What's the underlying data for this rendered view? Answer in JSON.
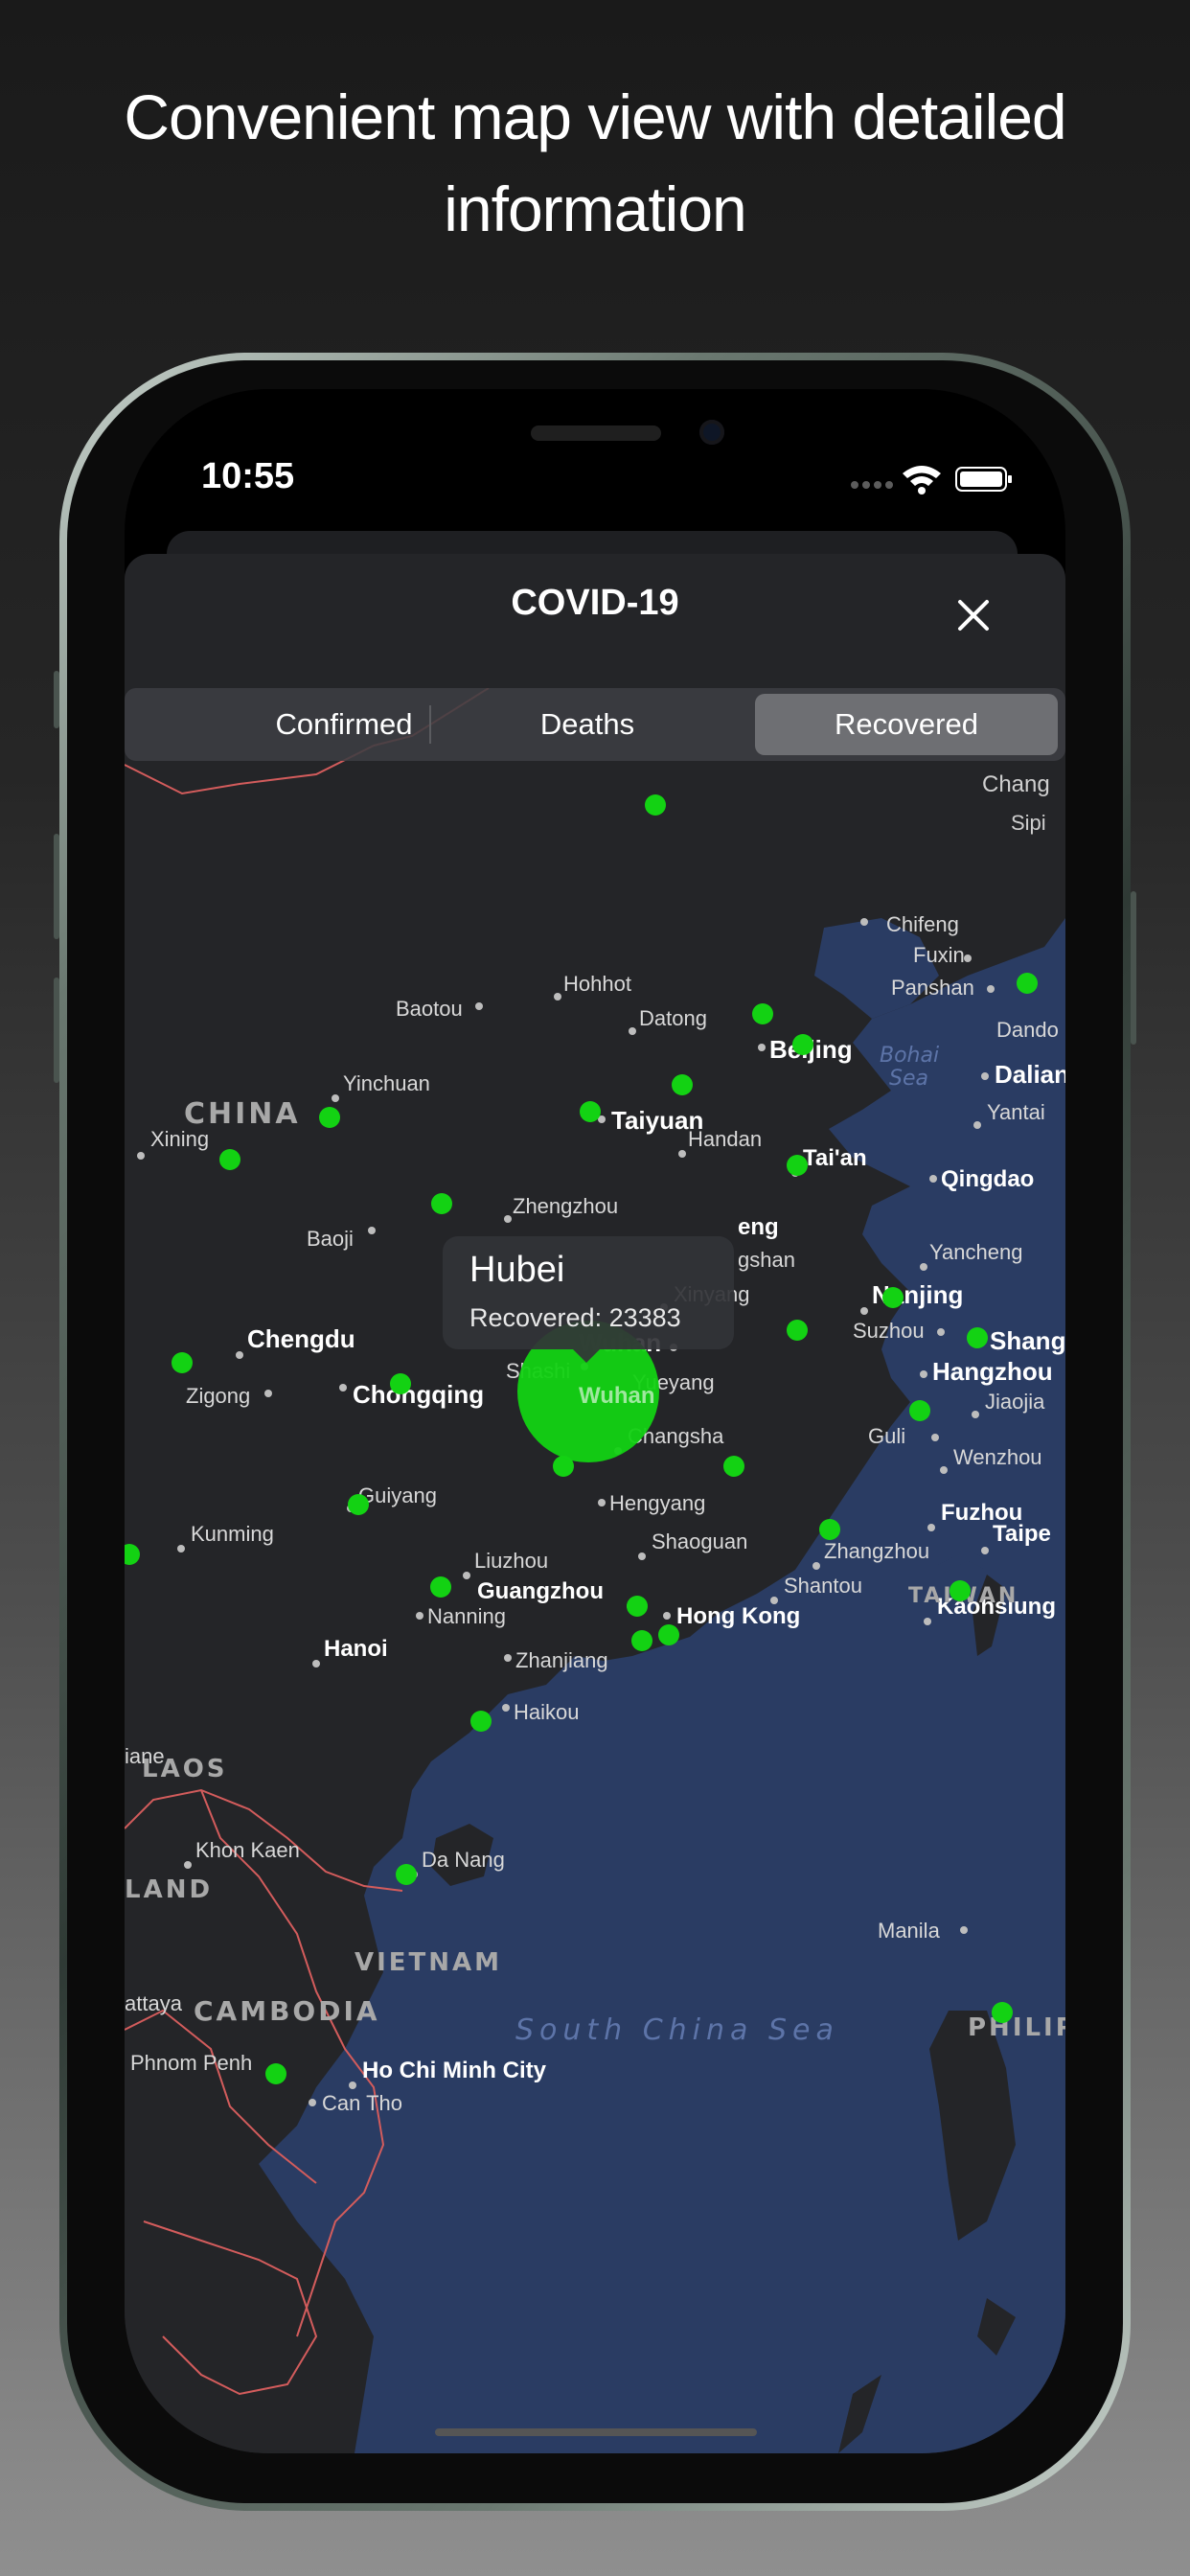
{
  "promo": {
    "headline_line1": "Convenient map view with detailed",
    "headline_line2": "information"
  },
  "status_bar": {
    "time": "10:55",
    "icons": [
      "signal-icon",
      "wifi-icon",
      "battery-icon"
    ]
  },
  "sheet": {
    "title": "COVID-19",
    "close_icon": "close-icon"
  },
  "segments": {
    "confirmed": "Confirmed",
    "deaths": "Deaths",
    "recovered": "Recovered",
    "selected": "Recovered"
  },
  "callout": {
    "region": "Hubei",
    "value_text": "Recovered: 23383"
  },
  "map": {
    "country_labels": {
      "china": "CHINA",
      "laos": "LAOS",
      "thailand": "LAND",
      "vietnam": "VIETNAM",
      "cambodia": "CAMBODIA",
      "taiwan": "TAIWAN",
      "philippines": "PHILIP"
    },
    "water_labels": {
      "bohai_1": "Bohai",
      "bohai_2": "Sea",
      "south_china_sea": "South China Sea"
    },
    "cities": {
      "chang": "Chang",
      "sipi": "Sipi",
      "chifeng": "Chifeng",
      "fuxin": "Fuxin",
      "panshan": "Panshan",
      "hohhot": "Hohhot",
      "baotou": "Baotou",
      "datong": "Datong",
      "beijing": "Beijing",
      "dandong": "Dando",
      "dalian": "Dalian",
      "yantai": "Yantai",
      "yinchuan": "Yinchuan",
      "taiyuan": "Taiyuan",
      "xining": "Xining",
      "handan": "Handan",
      "taian": "Tai'an",
      "qingdao": "Qingdao",
      "zhengzhou": "Zhengzhou",
      "kaifeng": "eng",
      "baoji": "Baoji",
      "pingdingshan": "gshan",
      "yancheng": "Yancheng",
      "xinyang": "Xinyang",
      "nanjing": "Nanjing",
      "chengdu": "Chengdu",
      "wuhan": "Wuhan",
      "suzhou": "Suzhou",
      "shanghai": "Shang",
      "shashi": "Shashi",
      "hangzhou": "Hangzhou",
      "zigong": "Zigong",
      "chongqing": "Chongqing",
      "yueyang": "Yueyang",
      "jiaojia": "Jiaojia",
      "changsha": "Changsha",
      "guli": "Guli",
      "wenzhou": "Wenzhou",
      "guiyang": "Guiyang",
      "hengyang": "Hengyang",
      "fuzhou": "Fuzhou",
      "kunming": "Kunming",
      "shaoguan": "Shaoguan",
      "zhangzhou": "Zhangzhou",
      "taipei": "Taipe",
      "liuzhou": "Liuzhou",
      "guangzhou": "Guangzhou",
      "shantou": "Shantou",
      "kaohsiung": "Kaohsiung",
      "nanning": "Nanning",
      "hong_kong": "Hong Kong",
      "hanoi": "Hanoi",
      "zhanjiang": "Zhanjiang",
      "haikou": "Haikou",
      "vientiane": "iane",
      "khon_kaen": "Khon Kaen",
      "da_nang": "Da Nang",
      "manila": "Manila",
      "pattaya": "attaya",
      "phnom_penh": "Phnom Penh",
      "ho_chi_minh": "Ho Chi Minh City",
      "can_tho": "Can Tho"
    }
  },
  "colors": {
    "marker": "#13d213",
    "water": "#2a3c63",
    "land": "#242528",
    "border": "#d35c5c"
  }
}
